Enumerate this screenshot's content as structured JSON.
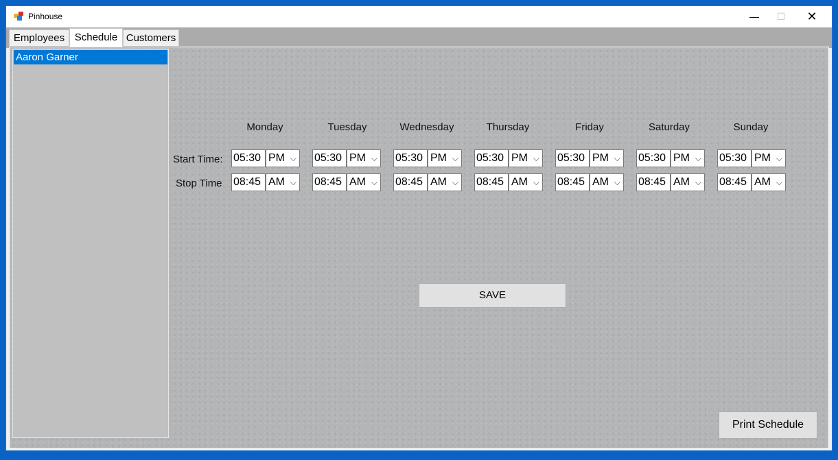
{
  "window": {
    "title": "Pinhouse",
    "minimize_icon": "minimize-icon",
    "maximize_icon": "maximize-icon",
    "close_icon": "close-icon"
  },
  "tabs": [
    {
      "label": "Employees"
    },
    {
      "label": "Schedule",
      "selected": true
    },
    {
      "label": "Customers"
    }
  ],
  "employees": [
    {
      "name": "Aaron Garner",
      "selected": true
    }
  ],
  "schedule": {
    "row_labels": {
      "start": "Start Time:",
      "stop": "Stop Time"
    },
    "days": [
      {
        "name": "Monday",
        "start_time": "05:30",
        "start_ampm": "PM",
        "stop_time": "08:45",
        "stop_ampm": "AM"
      },
      {
        "name": "Tuesday",
        "start_time": "05:30",
        "start_ampm": "PM",
        "stop_time": "08:45",
        "stop_ampm": "AM"
      },
      {
        "name": "Wednesday",
        "start_time": "05:30",
        "start_ampm": "PM",
        "stop_time": "08:45",
        "stop_ampm": "AM"
      },
      {
        "name": "Thursday",
        "start_time": "05:30",
        "start_ampm": "PM",
        "stop_time": "08:45",
        "stop_ampm": "AM"
      },
      {
        "name": "Friday",
        "start_time": "05:30",
        "start_ampm": "PM",
        "stop_time": "08:45",
        "stop_ampm": "AM"
      },
      {
        "name": "Saturday",
        "start_time": "05:30",
        "start_ampm": "PM",
        "stop_time": "08:45",
        "stop_ampm": "AM"
      },
      {
        "name": "Sunday",
        "start_time": "05:30",
        "start_ampm": "PM",
        "stop_time": "08:45",
        "stop_ampm": "AM"
      }
    ],
    "save_label": "SAVE",
    "print_label": "Print Schedule"
  },
  "colors": {
    "selection": "#0078d7",
    "panel_bg": "#b4b5b7",
    "list_bg": "#c0c0c0"
  }
}
